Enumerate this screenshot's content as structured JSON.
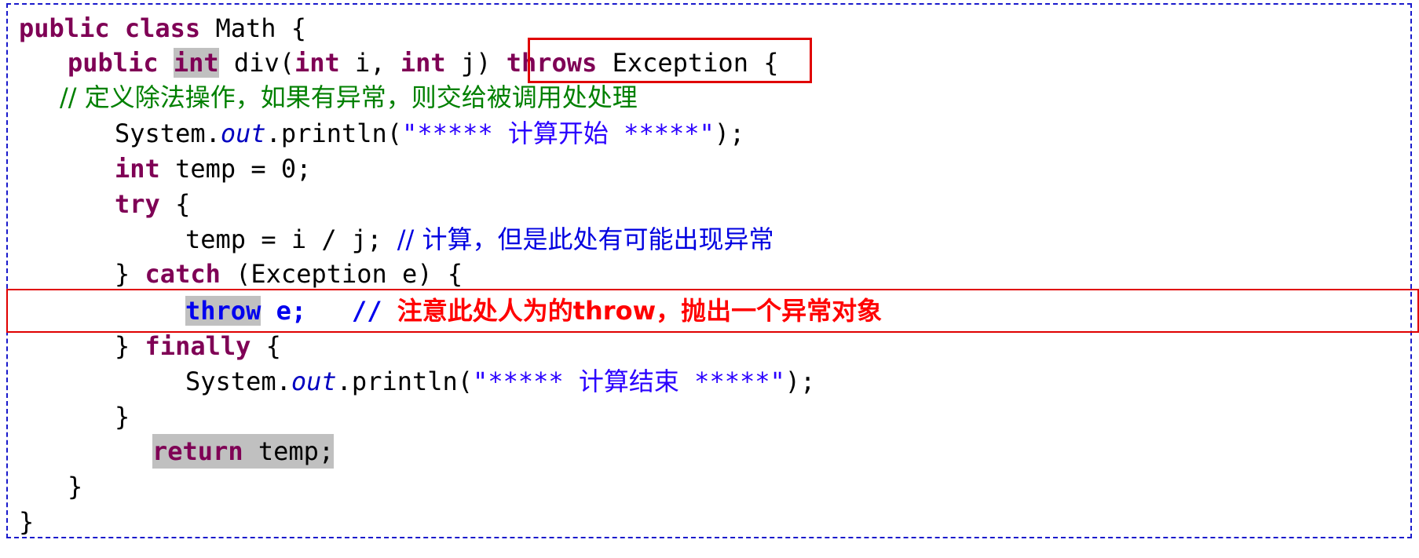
{
  "code": {
    "l1": {
      "kw": "public class",
      "rest": " Math {"
    },
    "l2": {
      "kw1": "public",
      "kw2": "int",
      "t1": " div(",
      "kw3": "int",
      "t2": " i, ",
      "kw4": "int",
      "t3": " j) ",
      "kw5": "throws",
      "t4": " Exception ",
      "t5": "{"
    },
    "l3": {
      "comment": "// 定义除法操作，如果有异常，则交给被调用处处理"
    },
    "l4": {
      "t1": "System.",
      "fld": "out",
      "t2": ".println(",
      "str": "\"***** 计算开始 *****\"",
      "t3": ");"
    },
    "l5": {
      "kw": "int",
      "rest": " temp = 0;"
    },
    "l6": {
      "kw": "try",
      "rest": " {"
    },
    "l7": {
      "code": "temp = i / j; ",
      "comment": "// 计算，但是此处有可能出现异常"
    },
    "l8": {
      "t1": "} ",
      "kw": "catch",
      "t2": " (Exception e) {"
    },
    "l9": {
      "kw": "throw",
      "code": " e;   ",
      "slashes": "// ",
      "comment": "注意此处人为的throw，抛出一个异常对象"
    },
    "l10": {
      "t1": "} ",
      "kw": "finally",
      "t2": " {"
    },
    "l11": {
      "t1": "System.",
      "fld": "out",
      "t2": ".println(",
      "str": "\"***** 计算结束 *****\"",
      "t3": ");"
    },
    "l12": {
      "t": "}"
    },
    "l13": {
      "kw": "return",
      "rest": " temp;"
    },
    "l14": {
      "t": "}"
    },
    "l15": {
      "t": "}"
    }
  },
  "colors": {
    "keyword": "#7f0055",
    "string": "#2a00ff",
    "comment_green": "#008000",
    "comment_blue": "#0000e0",
    "annotation_red": "#ff0000",
    "highlight_gray": "#c0c0c0",
    "frame_blue": "#1a1acc"
  }
}
